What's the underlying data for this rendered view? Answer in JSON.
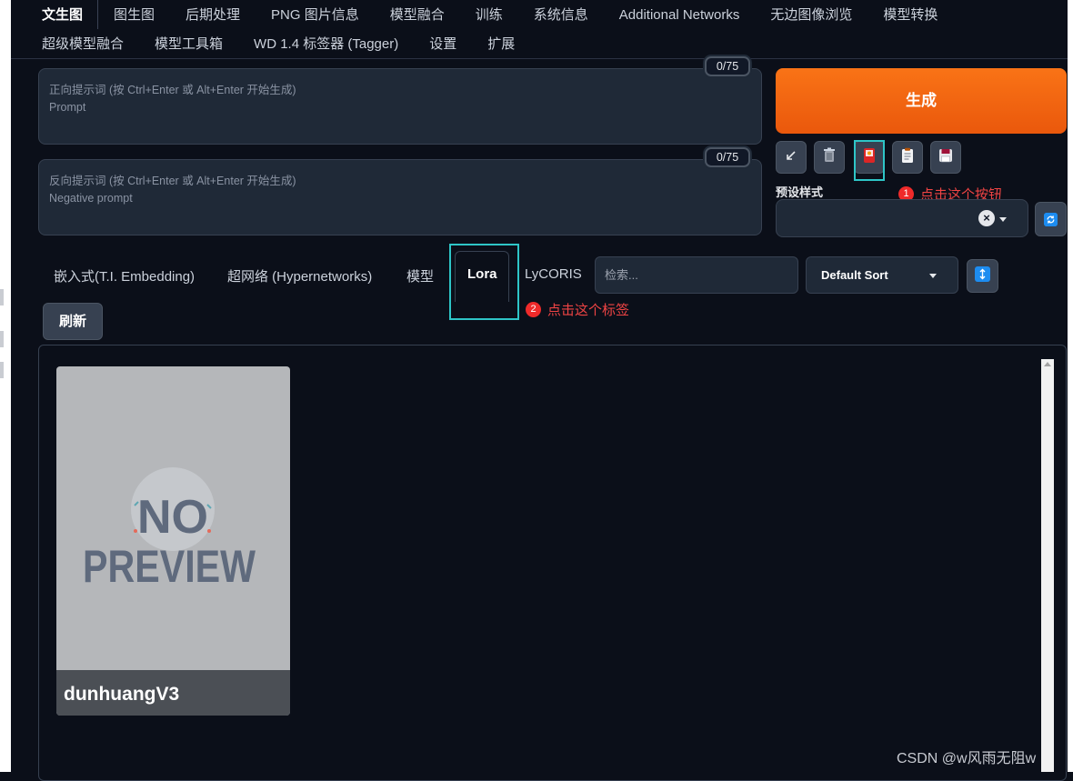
{
  "top_tabs_row1": [
    {
      "label": "文生图",
      "active": true
    },
    {
      "label": "图生图"
    },
    {
      "label": "后期处理"
    },
    {
      "label": "PNG 图片信息"
    },
    {
      "label": "模型融合"
    },
    {
      "label": "训练"
    },
    {
      "label": "系统信息"
    },
    {
      "label": "Additional Networks"
    },
    {
      "label": "无边图像浏览"
    },
    {
      "label": "模型转换"
    }
  ],
  "top_tabs_row2": [
    {
      "label": "超级模型融合"
    },
    {
      "label": "模型工具箱"
    },
    {
      "label": "WD 1.4 标签器 (Tagger)"
    },
    {
      "label": "设置"
    },
    {
      "label": "扩展"
    }
  ],
  "prompt": {
    "placeholder_line1": "正向提示词 (按 Ctrl+Enter 或 Alt+Enter 开始生成)",
    "placeholder_line2": "Prompt",
    "token_count": "0/75"
  },
  "negative_prompt": {
    "placeholder_line1": "反向提示词 (按 Ctrl+Enter 或 Alt+Enter 开始生成)",
    "placeholder_line2": "Negative prompt",
    "token_count": "0/75"
  },
  "generate": {
    "label": "生成"
  },
  "tool_buttons": [
    {
      "icon": "arrow-icon"
    },
    {
      "icon": "trash-icon"
    },
    {
      "icon": "extra-networks-icon"
    },
    {
      "icon": "clipboard-icon"
    },
    {
      "icon": "save-icon"
    }
  ],
  "styles": {
    "label": "预设样式",
    "clear": "×"
  },
  "annotations": {
    "note1": {
      "num": "1",
      "text": "点击这个按钮"
    },
    "note2": {
      "num": "2",
      "text": "点击这个标签"
    }
  },
  "extra_networks": {
    "tabs": [
      {
        "label": "嵌入式(T.I. Embedding)"
      },
      {
        "label": "超网络 (Hypernetworks)"
      },
      {
        "label": "模型"
      },
      {
        "label": "Lora",
        "active": true
      },
      {
        "label": "LyCORIS"
      }
    ],
    "search_placeholder": "检索...",
    "sort": "Default Sort",
    "refresh_label": "刷新",
    "cards": [
      {
        "name": "dunhuangV3",
        "preview_text_line1": "NO",
        "preview_text_line2": "PREVIEW"
      }
    ]
  },
  "watermark": "CSDN @w风雨无阻w",
  "colors": {
    "background": "#0b0f19",
    "accent_orange": "#f97316",
    "highlight_teal": "#2ec5c7",
    "annotation_red": "#ef4444"
  }
}
